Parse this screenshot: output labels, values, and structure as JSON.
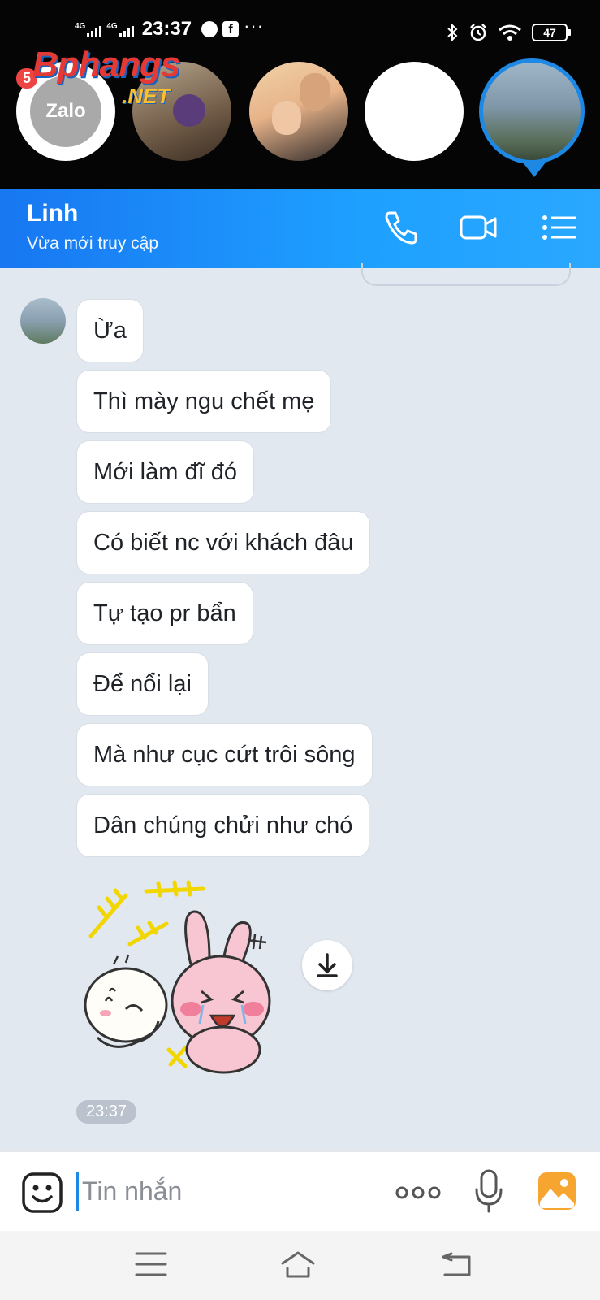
{
  "status_bar": {
    "network_1": "4G",
    "network_2": "4G",
    "time": "23:37",
    "fb_glyph": "f",
    "more": "···",
    "battery": "47"
  },
  "chat_heads": {
    "unread_badge": "5",
    "zalo_label": "Zalo",
    "watermark_1": "Bphangs",
    "watermark_2": ".NET"
  },
  "header": {
    "contact_name": "Linh",
    "status": "Vừa mới truy cập"
  },
  "messages": [
    {
      "text": "Ừa"
    },
    {
      "text": "Thì mày ngu chết mẹ"
    },
    {
      "text": "Mới làm đĩ đó"
    },
    {
      "text": "Có biết nc với khách đâu"
    },
    {
      "text": "Tự tạo pr bẩn"
    },
    {
      "text": "Để nổi lại"
    },
    {
      "text": "Mà như cục cứt trôi sông"
    },
    {
      "text": "Dân chúng chửi như chó"
    }
  ],
  "last_time": "23:37",
  "input": {
    "placeholder": "Tin nhắn"
  },
  "colors": {
    "header_gradient_start": "#1877f2",
    "header_gradient_end": "#2aa8ff",
    "active_ring": "#1e88e5",
    "chat_background": "#e2e8f0"
  },
  "icons": [
    "messenger-icon",
    "facebook-icon",
    "bluetooth-icon",
    "alarm-icon",
    "wifi-icon",
    "battery-icon",
    "phone-icon",
    "video-icon",
    "list-menu-icon",
    "download-icon",
    "emoji-icon",
    "more-dots-icon",
    "microphone-icon",
    "image-icon",
    "nav-menu-icon",
    "nav-home-icon",
    "nav-back-icon"
  ]
}
